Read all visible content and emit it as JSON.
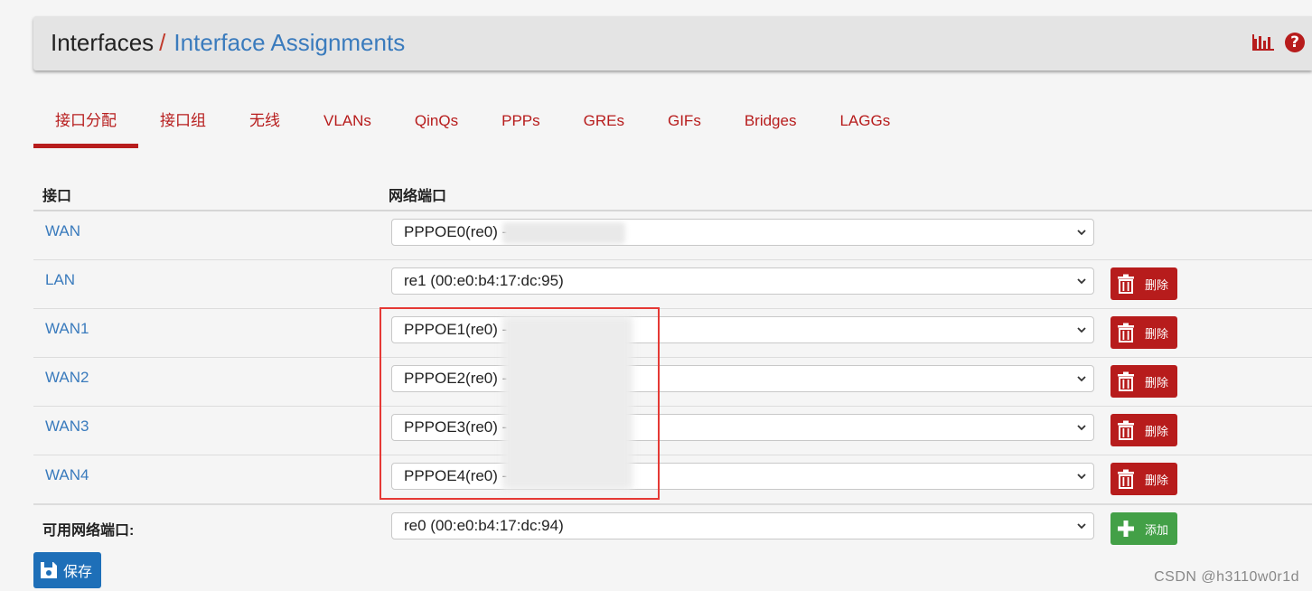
{
  "breadcrumb": {
    "section": "Interfaces",
    "separator": "/",
    "page": "Interface Assignments"
  },
  "header_icons": [
    "bar-chart-icon",
    "help-icon"
  ],
  "tabs": [
    {
      "label": "接口分配",
      "active": true
    },
    {
      "label": "接口组"
    },
    {
      "label": "无线"
    },
    {
      "label": "VLANs"
    },
    {
      "label": "QinQs"
    },
    {
      "label": "PPPs"
    },
    {
      "label": "GREs"
    },
    {
      "label": "GIFs"
    },
    {
      "label": "Bridges"
    },
    {
      "label": "LAGGs"
    }
  ],
  "table": {
    "headers": {
      "interface": "接口",
      "port": "网络端口"
    },
    "rows": [
      {
        "name": "WAN",
        "port": "PPPOE0(re0) -",
        "action": ""
      },
      {
        "name": "LAN",
        "port": "re1 (00:e0:b4:17:dc:95)",
        "action": "删除"
      },
      {
        "name": "WAN1",
        "port": "PPPOE1(re0) -",
        "action": "删除"
      },
      {
        "name": "WAN2",
        "port": "PPPOE2(re0) -",
        "action": "删除"
      },
      {
        "name": "WAN3",
        "port": "PPPOE3(re0) -",
        "action": "删除"
      },
      {
        "name": "WAN4",
        "port": "PPPOE4(re0) -",
        "action": "删除"
      }
    ],
    "available": {
      "label": "可用网络端口:",
      "port": "re0 (00:e0:b4:17:dc:94)",
      "action": "添加"
    }
  },
  "save_label": "保存",
  "watermark": "CSDN @h3110w0r1d",
  "colors": {
    "accent_red": "#b71c1c",
    "link_blue": "#3a7bbd",
    "add_green": "#43a047",
    "save_blue": "#1e6fb8",
    "highlight_red": "#e53935"
  }
}
